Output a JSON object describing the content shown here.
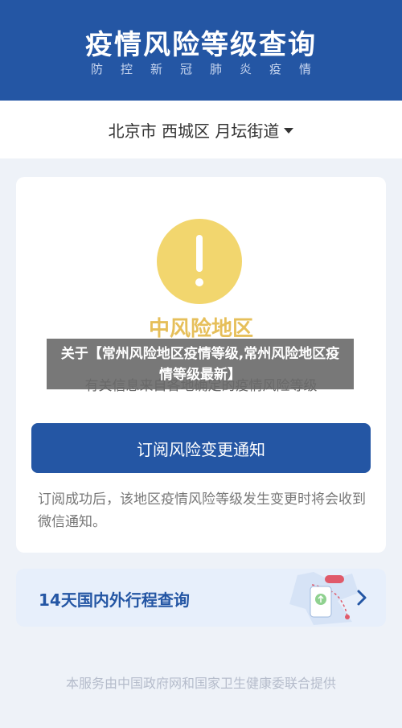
{
  "header": {
    "title": "疫情风险等级查询",
    "subtitle": "防控新冠肺炎疫情"
  },
  "location": {
    "text": "北京市 西城区 月坛街道"
  },
  "risk_card": {
    "level": "中风险地区",
    "note": "有关信息来自各地确定的疫情风险等级",
    "subscribe_button": "订阅风险变更通知",
    "subscribe_desc": "订阅成功后，该地区疫情风险等级发生变更时将会收到微信通知。"
  },
  "trip_query": {
    "label": "14天国内外行程查询"
  },
  "footer": {
    "text": "本服务由中国政府网和国家卫生健康委联合提供"
  },
  "overlay": {
    "text": "关于【常州风险地区疫情等级,常州风险地区疫情等级最新】"
  },
  "colors": {
    "primary": "#2456a4",
    "warning": "#f2d66e",
    "warning_text": "#e6bf5a"
  }
}
